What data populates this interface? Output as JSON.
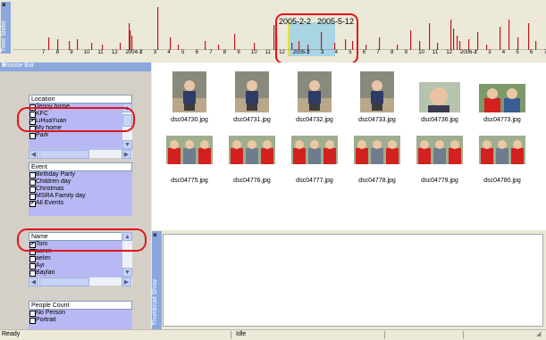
{
  "time_slider": {
    "side_label": "Time Slider",
    "close_label": "×",
    "selection_start": "2005-2-2",
    "selection_end": "2005-5-12",
    "axis_ticks": [
      "7",
      "8",
      "9",
      "10",
      "11",
      "12",
      "2004-1",
      "2",
      "3",
      "4",
      "5",
      "6",
      "7",
      "8",
      "9",
      "10",
      "11",
      "12",
      "2005-1",
      "2",
      "3",
      "4",
      "5",
      "6",
      "7",
      "8",
      "9",
      "10",
      "11",
      "12",
      "2006-1",
      "2",
      "3",
      "4",
      "5",
      "6",
      "7"
    ],
    "colors": {
      "bar": "#c01820",
      "selection": "#a9d4e3"
    }
  },
  "browse_bar": {
    "title": "Browse Bar",
    "close_label": "×",
    "location": {
      "title": "Location",
      "items": [
        {
          "label": "Jenny home",
          "checked": false
        },
        {
          "label": "KFC",
          "checked": false
        },
        {
          "label": "LiHuaYuan",
          "checked": true
        },
        {
          "label": "My home",
          "checked": false
        },
        {
          "label": "Park",
          "checked": false
        }
      ]
    },
    "event": {
      "title": "Event",
      "items": [
        {
          "label": "Birthday Party",
          "checked": false
        },
        {
          "label": "Children day",
          "checked": false
        },
        {
          "label": "Christmas",
          "checked": false
        },
        {
          "label": "MSRA Family day",
          "checked": false
        },
        {
          "label": "All Events",
          "checked": true
        }
      ]
    },
    "name": {
      "title": "Name",
      "items": [
        {
          "label": "Tom",
          "checked": true
        },
        {
          "label": "aaron",
          "checked": false
        },
        {
          "label": "aelim",
          "checked": false
        },
        {
          "label": "Ayi",
          "checked": false
        },
        {
          "label": "Baylan",
          "checked": false
        }
      ]
    },
    "people_count": {
      "title": "People Count",
      "items": [
        {
          "label": "No Person",
          "checked": false
        },
        {
          "label": "Portrait",
          "checked": false
        }
      ]
    }
  },
  "photos": [
    {
      "file": "dsc04730.jpg",
      "kind": "boy"
    },
    {
      "file": "dsc04731.jpg",
      "kind": "boy"
    },
    {
      "file": "dsc04732.jpg",
      "kind": "boy"
    },
    {
      "file": "dsc04733.jpg",
      "kind": "boy"
    },
    {
      "file": "dsc04736.jpg",
      "kind": "closeup"
    },
    {
      "file": "dsc04773.jpg",
      "kind": "kids"
    },
    {
      "file": "dsc04775.jpg",
      "kind": "group"
    },
    {
      "file": "dsc04776.jpg",
      "kind": "group"
    },
    {
      "file": "dsc04777.jpg",
      "kind": "group"
    },
    {
      "file": "dsc04778.jpg",
      "kind": "group"
    },
    {
      "file": "dsc04779.jpg",
      "kind": "group"
    },
    {
      "file": "dsc04780.jpg",
      "kind": "group"
    }
  ],
  "thumbnail_show": {
    "side_label": "Thumbnail Show",
    "close_label": "×"
  },
  "status_bar": {
    "left": "Ready",
    "middle": "Idle"
  }
}
